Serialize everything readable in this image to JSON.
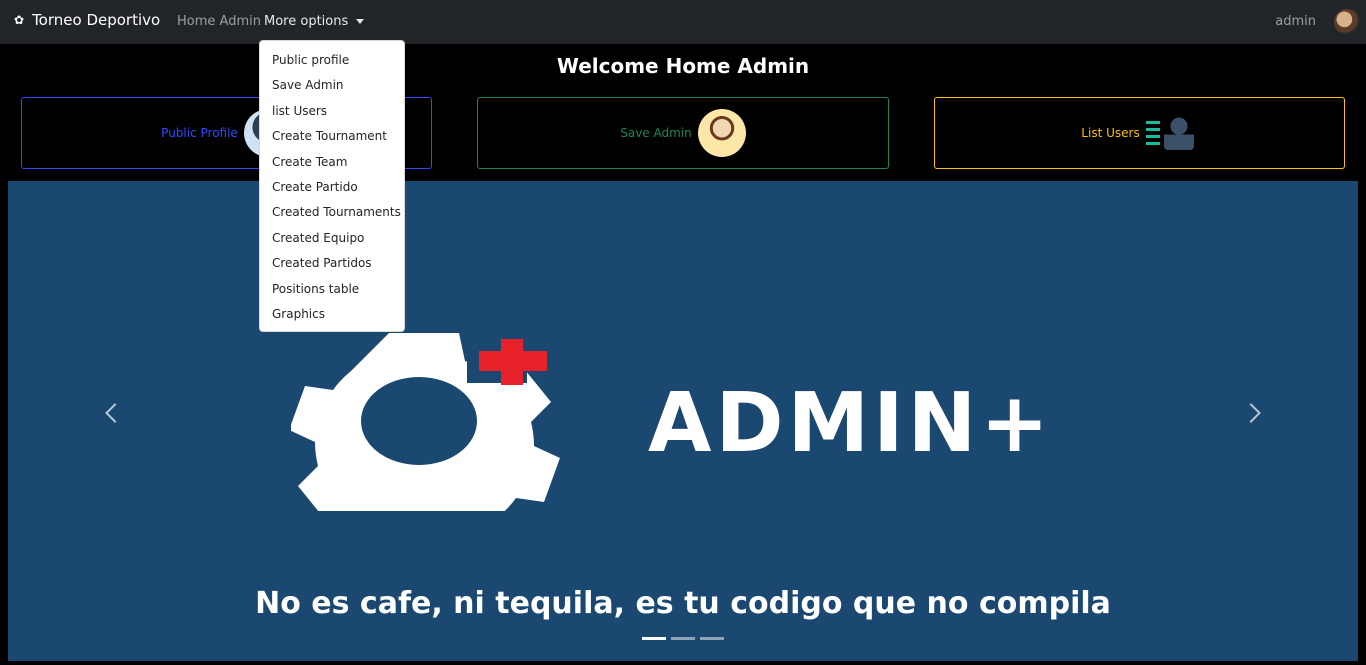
{
  "navbar": {
    "brand": "Torneo Deportivo",
    "brand_icon": "soccer-ball-icon",
    "home_link": "Home Admin",
    "more_options": "More options",
    "user": "admin"
  },
  "welcome_title": "Welcome Home Admin",
  "cards": [
    {
      "label": "Public Profile",
      "color": "#2f4bff"
    },
    {
      "label": "Save Admin",
      "color": "#198754"
    },
    {
      "label": "List Users",
      "color": "#ffc107"
    }
  ],
  "dropdown": {
    "items": [
      "Public profile",
      "Save Admin",
      "list Users",
      "Create Tournament",
      "Create Team",
      "Create Partido",
      "Created Tournaments",
      "Created Equipo",
      "Created Partidos",
      "Positions table",
      "Graphics"
    ]
  },
  "carousel": {
    "logo_text": "ADMIN+",
    "caption": "No es cafe, ni tequila, es tu codigo que no compila",
    "background": "#1a4870",
    "slides": 3,
    "active_slide": 1
  }
}
